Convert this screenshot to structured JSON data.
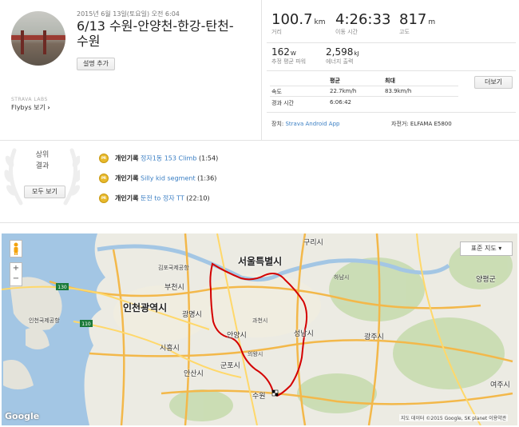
{
  "activity": {
    "date": "2015년 6월 13일(토요일) 오전 6:04",
    "title": "6/13 수원-안양천-한강-탄천-수원",
    "add_description": "설명 추가",
    "labs": "STRAVA LABS",
    "flybys": "Flybys 보기"
  },
  "stats": {
    "distance": {
      "value": "100.7",
      "unit": "km",
      "label": "거리"
    },
    "moving_time": {
      "value": "4:26:33",
      "label": "이동 시간"
    },
    "elevation": {
      "value": "817",
      "unit": "m",
      "label": "고도"
    },
    "power": {
      "value": "162",
      "unit": "W",
      "label": "추정 평균 파워"
    },
    "energy": {
      "value": "2,598",
      "unit": "kJ",
      "label": "에너지 출력"
    }
  },
  "detail_table": {
    "header_avg": "평균",
    "header_max": "최대",
    "more_button": "더보기",
    "rows": [
      {
        "label": "속도",
        "avg": "22.7km/h",
        "max": "83.9km/h"
      },
      {
        "label": "경과 시간",
        "avg": "6:06:42",
        "max": ""
      }
    ]
  },
  "device": {
    "label": "장치:",
    "value": "Strava Android App"
  },
  "bike": {
    "label": "자전거:",
    "value": "ELFAMA E5800"
  },
  "achievements": {
    "title_line1": "상위",
    "title_line2": "결과",
    "all_button": "모두 보기",
    "medal_text": "PR",
    "items": [
      {
        "prefix": "개인기록",
        "segment": "정자1동 153 Climb",
        "time": "(1:54)"
      },
      {
        "prefix": "개인기록",
        "segment": "Silly kid segment",
        "time": "(1:36)"
      },
      {
        "prefix": "개인기록",
        "segment": "둔전 to 정자 TT",
        "time": "(22:10)"
      }
    ]
  },
  "map": {
    "map_type": "표준 지도 ▾",
    "zoom_in": "+",
    "zoom_out": "−",
    "google": "Google",
    "attribution": "지도 데이터 ©2015 Google, SK planet  이용약관",
    "route_color": "#d40000",
    "labels": {
      "seoul": "서울특별시",
      "incheon": "인천광역시",
      "guri": "구리시",
      "bucheon": "부천시",
      "gwangmyeong": "광명시",
      "anyang": "안양시",
      "gwacheon": "과천시",
      "seongnam": "성남시",
      "gwangju": "광주시",
      "siheung": "시흥시",
      "uiwang": "의왕시",
      "gunpo": "군포시",
      "ansan": "안산시",
      "suwon": "수원",
      "hanam": "하남시",
      "yangpyeong": "양평군",
      "yeoju": "여주시",
      "gimpo_airport": "김포국제공항",
      "incheon_airport": "인천국제공항",
      "hwy130": "130",
      "hwy110": "110"
    }
  }
}
